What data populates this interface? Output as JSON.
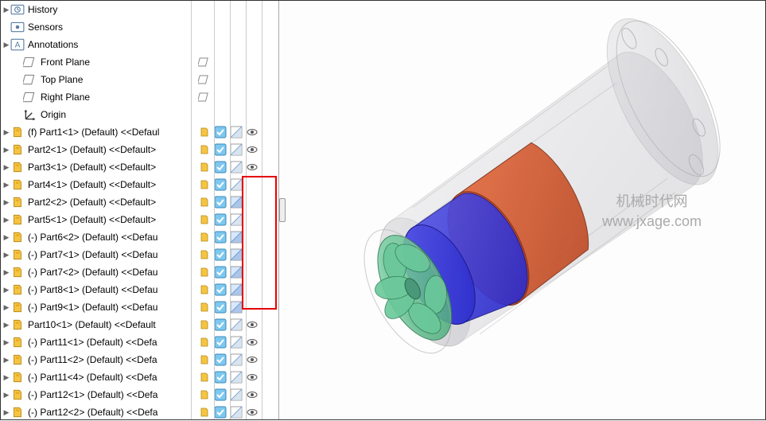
{
  "tree": {
    "history": "History",
    "sensors": "Sensors",
    "annotations": "Annotations",
    "front_plane": "Front Plane",
    "top_plane": "Top Plane",
    "right_plane": "Right Plane",
    "origin": "Origin",
    "parts": [
      "(f) Part1<1> (Default) <<Defaul",
      "Part2<1> (Default) <<Default>",
      "Part3<1> (Default) <<Default>",
      "Part4<1> (Default) <<Default>",
      "Part2<2> (Default) <<Default>",
      "Part5<1> (Default) <<Default>",
      "(-) Part6<2> (Default) <<Defau",
      "(-) Part7<1> (Default) <<Defau",
      "(-) Part7<2> (Default) <<Defau",
      "(-) Part8<1> (Default) <<Defau",
      "(-) Part9<1> (Default) <<Defau",
      "Part10<1> (Default) <<Default",
      "(-) Part11<1> (Default) <<Defa",
      "(-) Part11<2> (Default) <<Defa",
      "(-) Part11<4> (Default) <<Defa",
      "(-) Part12<1> (Default) <<Defa",
      "(-) Part12<2> (Default) <<Defa"
    ]
  },
  "columns": {
    "plane_rows": 3,
    "part_rows": 17,
    "eye_rows": [
      0,
      1,
      2,
      11,
      12,
      13,
      14,
      15,
      16
    ],
    "highlight_display_rows": [
      4,
      6,
      7,
      8,
      9,
      10
    ]
  },
  "watermark": {
    "line1": "机械时代网",
    "line2": "www.jxage.com"
  }
}
